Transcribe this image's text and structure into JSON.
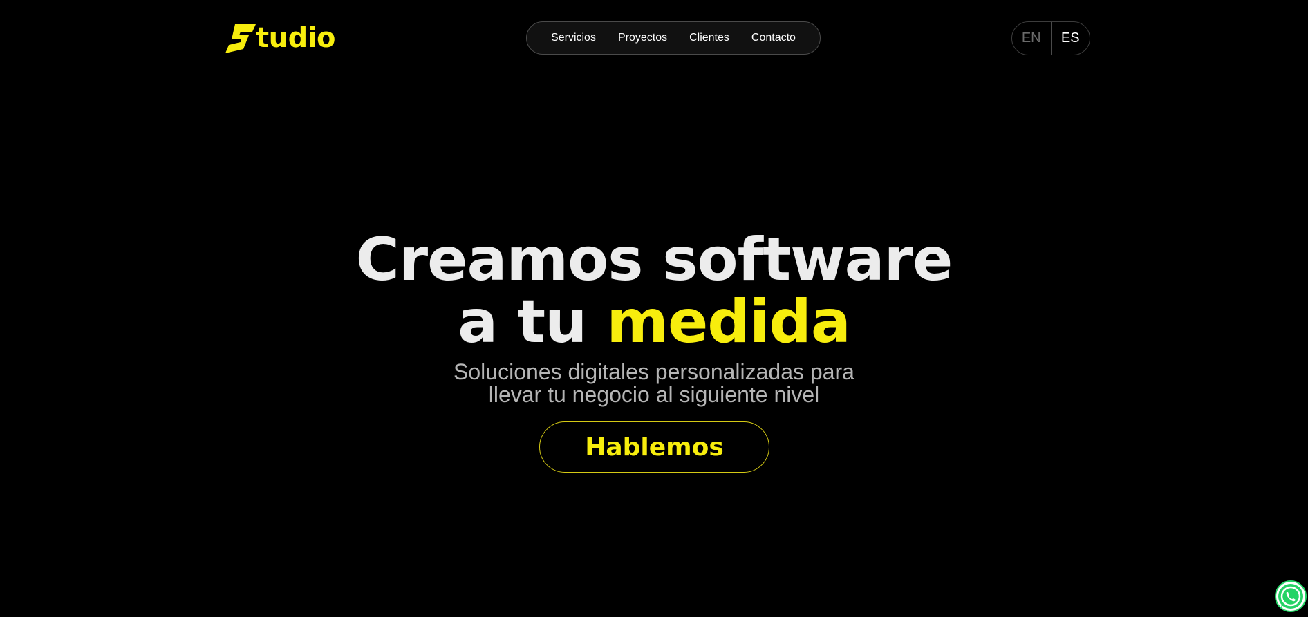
{
  "header": {
    "logo_text": "tudio",
    "nav": [
      {
        "label": "Servicios"
      },
      {
        "label": "Proyectos"
      },
      {
        "label": "Clientes"
      },
      {
        "label": "Contacto"
      }
    ],
    "lang": {
      "en": "EN",
      "es": "ES",
      "active": "ES"
    }
  },
  "hero": {
    "line1": "Creamos software",
    "line2_prefix": "a tu ",
    "line2_highlight": "medida",
    "subtitle_line1": "Soluciones digitales personalizadas para",
    "subtitle_line2": "llevar tu negocio al siguiente nivel",
    "cta_label": "Hablemos"
  },
  "colors": {
    "background": "#000000",
    "accent": "#f7ed0d",
    "text": "#ececec",
    "muted": "#b5b5b5"
  },
  "icons": {
    "logo_mark": "s-bolt-icon",
    "floating": "whatsapp-icon"
  }
}
